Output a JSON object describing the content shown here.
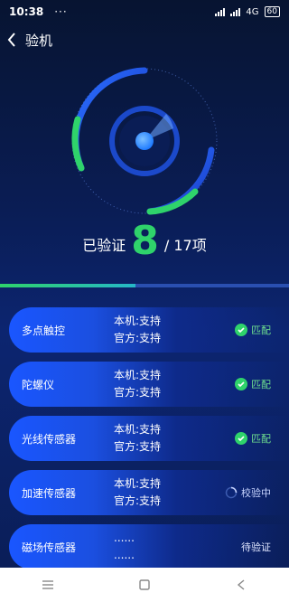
{
  "status_bar": {
    "time": "10:38",
    "dots": "···",
    "network": "4G",
    "battery": "60"
  },
  "nav": {
    "title": "验机"
  },
  "progress": {
    "verified_label": "已验证",
    "verified_count": "8",
    "total_label": "/ 17项",
    "fraction": 0.47
  },
  "items": [
    {
      "name": "多点触控",
      "local": "本机:支持",
      "official": "官方:支持",
      "status": "匹配",
      "state": "match"
    },
    {
      "name": "陀螺仪",
      "local": "本机:支持",
      "official": "官方:支持",
      "status": "匹配",
      "state": "match"
    },
    {
      "name": "光线传感器",
      "local": "本机:支持",
      "official": "官方:支持",
      "status": "匹配",
      "state": "match"
    },
    {
      "name": "加速传感器",
      "local": "本机:支持",
      "official": "官方:支持",
      "status": "校验中",
      "state": "checking"
    },
    {
      "name": "磁场传感器",
      "local": "......",
      "official": "......",
      "status": "待验证",
      "state": "pending"
    }
  ],
  "colors": {
    "accent_green": "#2fd36b",
    "accent_blue": "#1a56ff",
    "background": "#0a1d55"
  }
}
